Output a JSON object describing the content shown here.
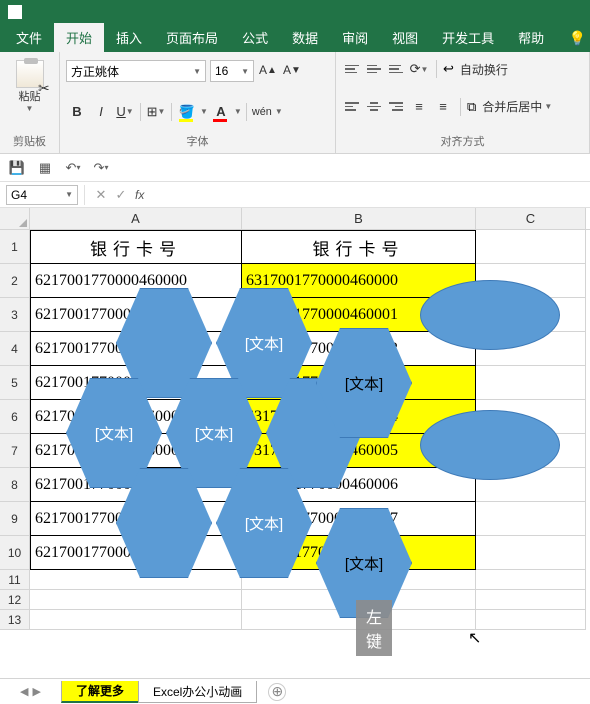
{
  "tabs": {
    "file": "文件",
    "home": "开始",
    "insert": "插入",
    "layout": "页面布局",
    "formulas": "公式",
    "data": "数据",
    "review": "审阅",
    "view": "视图",
    "dev": "开发工具",
    "help": "帮助"
  },
  "ribbon": {
    "paste": "粘贴",
    "clipboard_label": "剪贴板",
    "font_label": "字体",
    "align_label": "对齐方式",
    "font_name": "方正姚体",
    "font_size": "16",
    "wrap": "自动换行",
    "merge": "合并后居中"
  },
  "name_box": "G4",
  "columns": [
    "A",
    "B",
    "C"
  ],
  "rows": [
    "1",
    "2",
    "3",
    "4",
    "5",
    "6",
    "7",
    "8",
    "9",
    "10",
    "11",
    "12",
    "13"
  ],
  "table": {
    "header_a": "银行卡号",
    "header_b": "银行卡号",
    "data": [
      {
        "a": "6217001770000460000",
        "b": "6317001770000460000"
      },
      {
        "a": "6217001770000460001",
        "b": "6317001770000460001"
      },
      {
        "a": "6217001770000460002",
        "b": "6317001770000460002"
      },
      {
        "a": "6217001770000460003",
        "b": "6317001770000460003"
      },
      {
        "a": "6217001770000460004",
        "b": "6317001770000460004"
      },
      {
        "a": "6217001770000460005",
        "b": "6317001770000460005"
      },
      {
        "a": "6217001770000460006",
        "b": "6317001770000460006"
      },
      {
        "a": "6217001770000460007",
        "b": "6317001770000460007"
      },
      {
        "a": "6217001770000460008",
        "b": "6317001770000460008"
      }
    ]
  },
  "shape_text": "[文本]",
  "shape_text2": "[文本]",
  "hint": "左键",
  "sheets": {
    "s1": "了解更多",
    "s2": "Excel办公小动画"
  }
}
